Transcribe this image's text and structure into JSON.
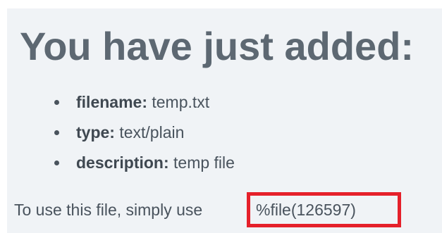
{
  "heading": "You have just added:",
  "details": [
    {
      "key": "filename:",
      "value": "temp.txt"
    },
    {
      "key": "type:",
      "value": "text/plain"
    },
    {
      "key": "description:",
      "value": "temp file"
    }
  ],
  "usage": {
    "text": "To use this file, simply use",
    "code": "%file(126597)"
  },
  "colors": {
    "panel_background": "#f0f3f6",
    "heading": "#5d6872",
    "body_text": "#49535d",
    "highlight_border": "#e5202a"
  }
}
